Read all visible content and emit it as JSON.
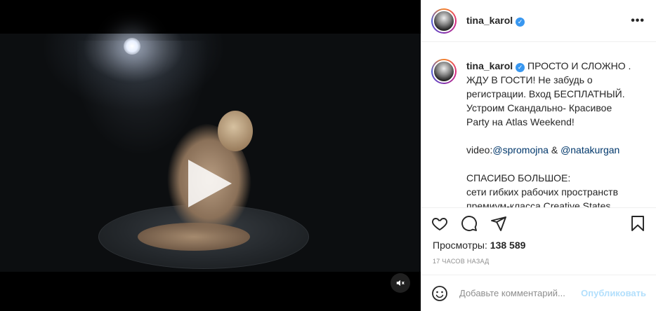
{
  "post": {
    "username": "tina_karol",
    "verified": true
  },
  "caption": {
    "username": "tina_karol",
    "line1": " ПРОСТО И СЛОЖНО . ЖДУ В ГОСТИ!  Не забудь о регистрации. Вход БЕСПЛАТНЫЙ. Устроим Скандально- Красивое Party на Atlas Weekend!",
    "video_prefix": "video:",
    "mention1": "@spromojna",
    "amp": " & ",
    "mention2": "@natakurgan",
    "thanks_title": "СПАСИБО БОЛЬШОЕ:",
    "thanks_line": "сети гибких рабочих пространств премиум-класса Creative States"
  },
  "stats": {
    "views_label": "Просмотры:",
    "views_value": "138 589",
    "time": "17 часов назад"
  },
  "comment": {
    "placeholder": "Добавьте комментарий...",
    "publish_label": "Опубликовать"
  },
  "icons": {
    "like": "heart-icon",
    "comment": "comment-icon",
    "share": "share-icon",
    "save": "bookmark-icon",
    "emoji": "emoji-icon",
    "mute": "mute-icon",
    "play": "play-icon"
  },
  "colors": {
    "verified": "#3897f0",
    "mention": "#00376b",
    "publish": "#b2dffc"
  }
}
